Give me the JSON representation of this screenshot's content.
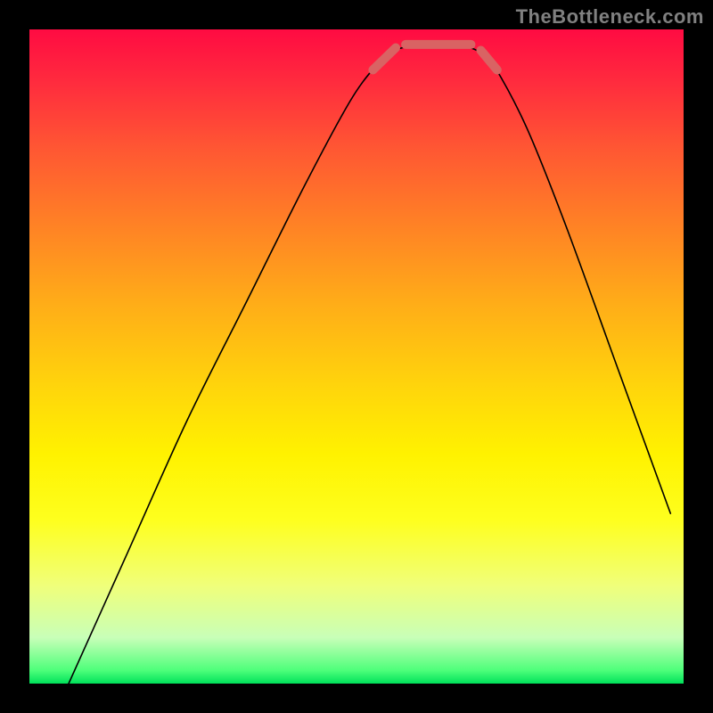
{
  "watermark": "TheBottleneck.com",
  "chart_data": {
    "type": "line",
    "title": "",
    "xlabel": "",
    "ylabel": "",
    "x_range": [
      0,
      100
    ],
    "y_range": [
      0,
      100
    ],
    "background": "rainbow-vertical-gradient",
    "curve": {
      "color": "#000000",
      "points_xy_pct": [
        [
          6,
          0
        ],
        [
          15,
          20
        ],
        [
          24,
          40
        ],
        [
          33,
          58
        ],
        [
          42,
          76
        ],
        [
          49,
          89
        ],
        [
          53,
          94.5
        ],
        [
          55,
          96.5
        ],
        [
          60,
          97.8
        ],
        [
          65,
          97.8
        ],
        [
          69,
          96.5
        ],
        [
          71,
          94.5
        ],
        [
          76,
          85
        ],
        [
          82,
          70
        ],
        [
          90,
          48
        ],
        [
          98,
          26
        ]
      ]
    },
    "highlight_segments": {
      "color": "#d96363",
      "stroke_width_px": 10,
      "segments_xy_pct": [
        [
          [
            52.5,
            93.8
          ],
          [
            56.0,
            97.2
          ]
        ],
        [
          [
            57.5,
            97.7
          ],
          [
            67.5,
            97.7
          ]
        ],
        [
          [
            69.0,
            96.8
          ],
          [
            71.5,
            93.8
          ]
        ]
      ]
    }
  }
}
